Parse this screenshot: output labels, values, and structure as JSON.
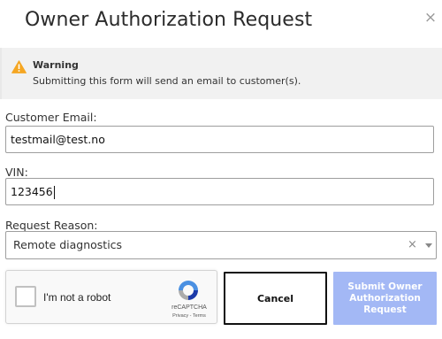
{
  "dialog": {
    "title": "Owner Authorization Request",
    "close_icon": "×"
  },
  "warning": {
    "icon": "warning-triangle-icon",
    "title": "Warning",
    "text": "Submitting this form will send an email to customer(s).",
    "icon_color": "#f5a623"
  },
  "form": {
    "email": {
      "label": "Customer Email:",
      "value": "testmail@test.no"
    },
    "vin": {
      "label": "VIN:",
      "value": "123456"
    },
    "reason": {
      "label": "Request Reason:",
      "selected": "Remote diagnostics",
      "clear_icon": "×"
    }
  },
  "recaptcha": {
    "checkbox_label": "I'm not a robot",
    "brand": "reCAPTCHA",
    "links": "Privacy - Terms"
  },
  "buttons": {
    "cancel": "Cancel",
    "submit": "Submit Owner Authorization Request",
    "submit_color": "#a3b8f5"
  }
}
